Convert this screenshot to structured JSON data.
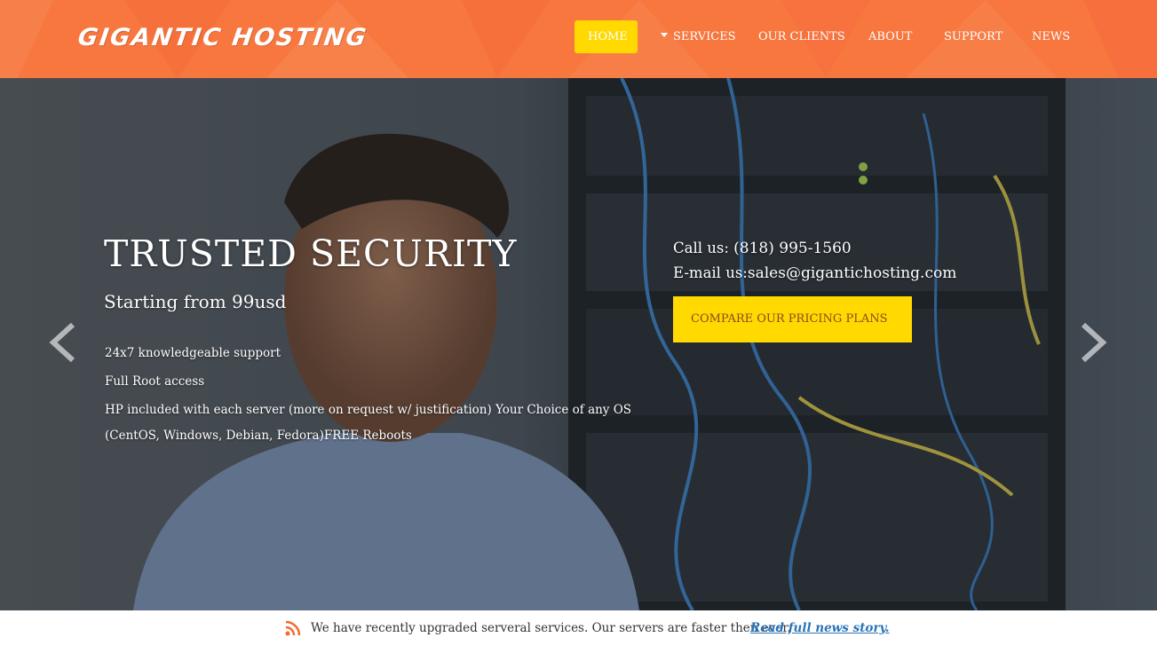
{
  "header": {
    "logo_text": "GIGANTIC HOSTING",
    "brand_color": "#f7773f",
    "nav": [
      {
        "label": "HOME",
        "active": true
      },
      {
        "label": "SERVICES",
        "has_dropdown": true
      },
      {
        "label": "OUR CLIENTS"
      },
      {
        "label": "ABOUT"
      },
      {
        "label": "SUPPORT"
      },
      {
        "label": "NEWS"
      }
    ]
  },
  "slide": {
    "title": "TRUSTED SECURITY",
    "subtitle": "Starting from 99usd",
    "features": [
      "24x7 knowledgeable support",
      "Full Root access",
      "HP included with each server (more on request w/ justification) Your Choice of any OS (CentOS, Windows, Debian, Fedora)FREE Reboots"
    ],
    "contact": {
      "phone_label": "Call us: ",
      "phone": "(818) 995-1560",
      "email_label": "E-mail us:",
      "email": "sales@gigantichosting.com"
    },
    "cta_label": "COMPARE OUR PRICING PLANS",
    "accent_color": "#ffd900",
    "prev_icon": "chevron-left-icon",
    "next_icon": "chevron-right-icon"
  },
  "news": {
    "icon": "rss-icon",
    "text": "We have recently upgraded serveral services. Our servers are faster then ever.",
    "link_label": "Read full news story."
  }
}
